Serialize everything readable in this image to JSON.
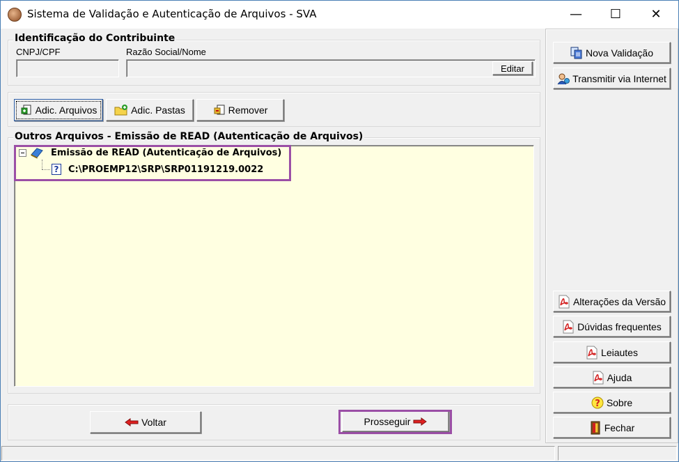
{
  "window": {
    "title": "Sistema de Validação e Autenticação de Arquivos - SVA",
    "minimize": "—",
    "maximize": "☐",
    "close": "✕"
  },
  "contributor": {
    "section_title": "Identificação do Contribuinte",
    "cnpj_label": "CNPJ/CPF",
    "cnpj_value": "",
    "name_label": "Razão Social/Nome",
    "name_value": "",
    "edit_label": "Editar"
  },
  "toolbar": {
    "add_files_label": "Adic. Arquivos",
    "add_folders_label": "Adic. Pastas",
    "remove_label": "Remover"
  },
  "files": {
    "section_title": "Outros Arquivos - Emissão de READ (Autenticação de Arquivos)",
    "root_node": "Emissão de READ (Autenticação de Arquivos)",
    "child_node": "C:\\PROEMP12\\SRP\\SRP01191219.0022",
    "expander": "⊟"
  },
  "footer": {
    "back_label": "Voltar",
    "proceed_label": "Prosseguir"
  },
  "side_panel": {
    "new_validation": "Nova Validação",
    "transmit": "Transmitir via Internet",
    "version_changes": "Alterações da Versão",
    "faq": "Dúvidas frequentes",
    "layouts": "Leiautes",
    "help": "Ajuda",
    "about": "Sobre",
    "close": "Fechar"
  },
  "colors": {
    "highlight": "#9b4fa6",
    "tree_background": "#ffffe1",
    "pdf_red": "#d32020",
    "arrow_red": "#e02020"
  }
}
